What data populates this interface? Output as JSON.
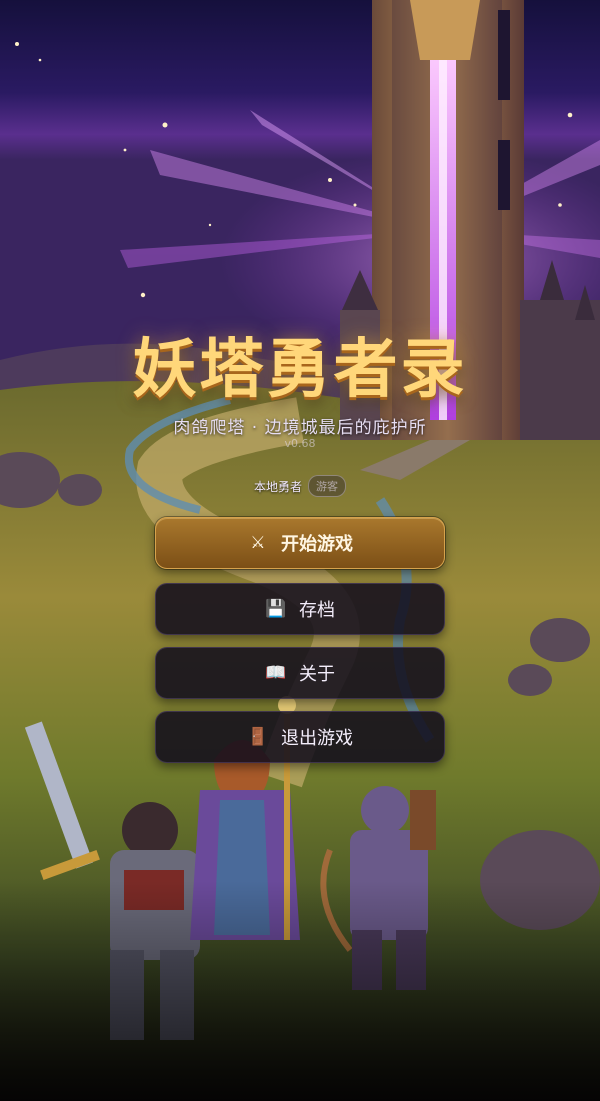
{
  "title": "妖塔勇者录",
  "subtitle": "肉鸽爬塔 · 边境城最后的庇护所",
  "version": "v0.68",
  "player": {
    "label": "本地勇者",
    "tag": "游客"
  },
  "menu": {
    "start": {
      "icon": "⚔",
      "label": "开始游戏",
      "icon_name": "crossed-swords-icon"
    },
    "save": {
      "icon": "💾",
      "label": "存档",
      "icon_name": "floppy-disk-icon"
    },
    "about": {
      "icon": "📖",
      "label": "关于",
      "icon_name": "open-book-icon"
    },
    "exit": {
      "icon": "🚪",
      "label": "退出游戏",
      "icon_name": "door-icon"
    }
  },
  "colors": {
    "title_gold": "#ffd77a",
    "primary_button": "#9a6a24",
    "secondary_button": "#100c1c",
    "sky_top": "#1c1248",
    "sky_glow": "#7a3fb0"
  }
}
